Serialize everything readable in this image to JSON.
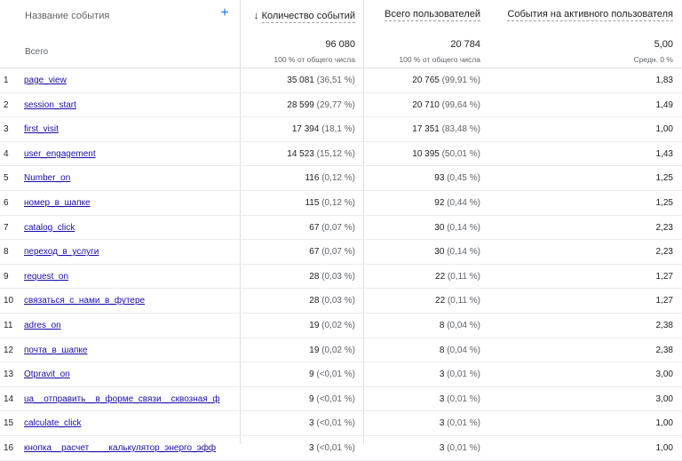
{
  "header": {
    "event_name": "Название события",
    "add_dimension": "+",
    "sort_arrow": "arrow-down-icon",
    "col_events": "Количество событий",
    "col_users": "Всего пользователей",
    "col_per_user": "События на активного пользователя"
  },
  "totals": {
    "label": "Всего",
    "events": "96 080",
    "events_sub": "100 % от общего числа",
    "users": "20 784",
    "users_sub": "100 % от общего числа",
    "per_user": "5,00",
    "per_user_sub": "Средн. 0 %"
  },
  "rows": [
    {
      "idx": "1",
      "name": "page_view",
      "events": "35 081",
      "events_pct": "(36,51 %)",
      "users": "20 765",
      "users_pct": "(99,91 %)",
      "per_user": "1,83"
    },
    {
      "idx": "2",
      "name": "session_start",
      "events": "28 599",
      "events_pct": "(29,77 %)",
      "users": "20 710",
      "users_pct": "(99,64 %)",
      "per_user": "1,49"
    },
    {
      "idx": "3",
      "name": "first_visit",
      "events": "17 394",
      "events_pct": "(18,1 %)",
      "users": "17 351",
      "users_pct": "(83,48 %)",
      "per_user": "1,00"
    },
    {
      "idx": "4",
      "name": "user_engagement",
      "events": "14 523",
      "events_pct": "(15,12 %)",
      "users": "10 395",
      "users_pct": "(50,01 %)",
      "per_user": "1,43"
    },
    {
      "idx": "5",
      "name": "Number_on",
      "events": "116",
      "events_pct": "(0,12 %)",
      "users": "93",
      "users_pct": "(0,45 %)",
      "per_user": "1,25"
    },
    {
      "idx": "6",
      "name": "номер_в_шапке",
      "events": "115",
      "events_pct": "(0,12 %)",
      "users": "92",
      "users_pct": "(0,44 %)",
      "per_user": "1,25"
    },
    {
      "idx": "7",
      "name": "catalog_click",
      "events": "67",
      "events_pct": "(0,07 %)",
      "users": "30",
      "users_pct": "(0,14 %)",
      "per_user": "2,23"
    },
    {
      "idx": "8",
      "name": "переход_в_услуги",
      "events": "67",
      "events_pct": "(0,07 %)",
      "users": "30",
      "users_pct": "(0,14 %)",
      "per_user": "2,23"
    },
    {
      "idx": "9",
      "name": "request_on",
      "events": "28",
      "events_pct": "(0,03 %)",
      "users": "22",
      "users_pct": "(0,11 %)",
      "per_user": "1,27"
    },
    {
      "idx": "10",
      "name": "связаться_с_нами_в_футере",
      "events": "28",
      "events_pct": "(0,03 %)",
      "users": "22",
      "users_pct": "(0,11 %)",
      "per_user": "1,27"
    },
    {
      "idx": "11",
      "name": "adres_on",
      "events": "19",
      "events_pct": "(0,02 %)",
      "users": "8",
      "users_pct": "(0,04 %)",
      "per_user": "2,38"
    },
    {
      "idx": "12",
      "name": "почта_в_шапке",
      "events": "19",
      "events_pct": "(0,02 %)",
      "users": "8",
      "users_pct": "(0,04 %)",
      "per_user": "2,38"
    },
    {
      "idx": "13",
      "name": "Otpravit_on",
      "events": "9",
      "events_pct": "(<0,01 %)",
      "users": "3",
      "users_pct": "(0,01 %)",
      "per_user": "3,00"
    },
    {
      "idx": "14",
      "name": "ua__отправить__в_форме_связи__сквозная_ф",
      "events": "9",
      "events_pct": "(<0,01 %)",
      "users": "3",
      "users_pct": "(0,01 %)",
      "per_user": "3,00"
    },
    {
      "idx": "15",
      "name": "calculate_click",
      "events": "3",
      "events_pct": "(<0,01 %)",
      "users": "3",
      "users_pct": "(0,01 %)",
      "per_user": "1,00"
    },
    {
      "idx": "16",
      "name": "кнопка__расчет____калькулятор_энерго_эфф",
      "events": "3",
      "events_pct": "(<0,01 %)",
      "users": "3",
      "users_pct": "(0,01 %)",
      "per_user": "1,00"
    }
  ]
}
